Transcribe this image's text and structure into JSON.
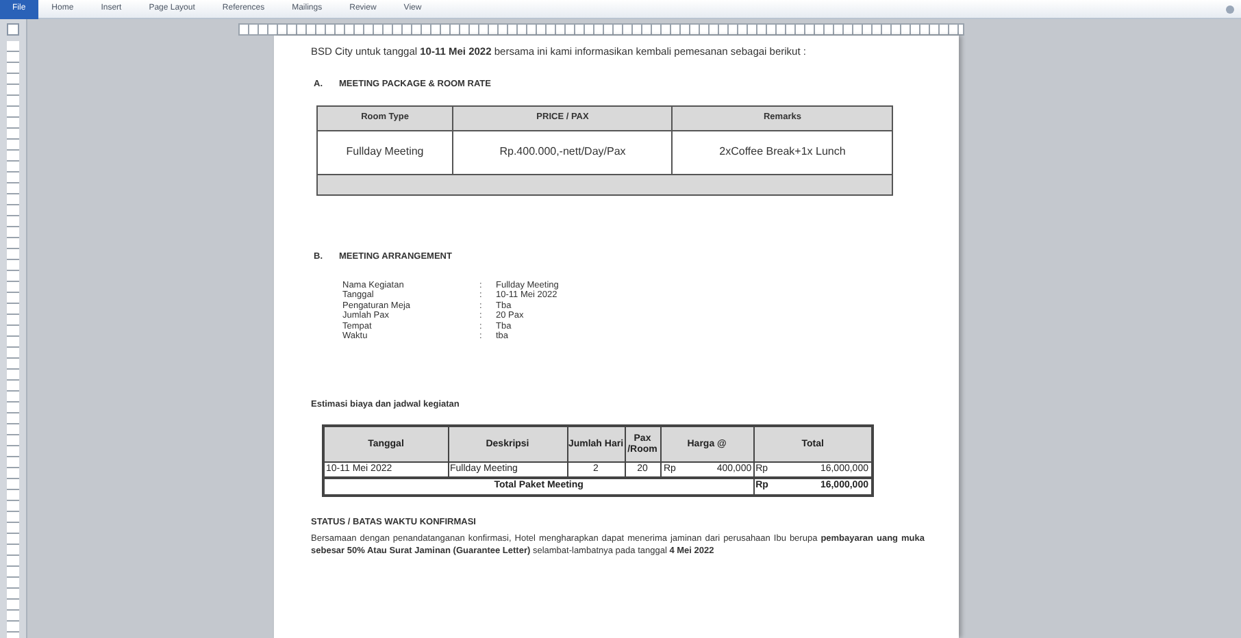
{
  "ribbon": {
    "tabs": [
      {
        "label": "File",
        "selected": true
      },
      {
        "label": "Home",
        "selected": false
      },
      {
        "label": "Insert",
        "selected": false
      },
      {
        "label": "Page Layout",
        "selected": false
      },
      {
        "label": "References",
        "selected": false
      },
      {
        "label": "Mailings",
        "selected": false
      },
      {
        "label": "Review",
        "selected": false
      },
      {
        "label": "View",
        "selected": false
      }
    ]
  },
  "document": {
    "intro": "BSD City untuk tanggal **10-11 Mei 2022** bersama ini kami informasikan kembali pemesanan sebagai berikut :",
    "section_a": {
      "number": "A.",
      "heading": "MEETING PACKAGE & ROOM RATE",
      "table": {
        "columns": [
          "Room Type",
          "PRICE / PAX",
          "Remarks"
        ],
        "rows": [
          [
            "Fullday Meeting",
            "Rp.400.000,-nett/Day/Pax",
            "2xCoffee Break+1x Lunch"
          ]
        ]
      }
    },
    "section_b": {
      "number": "B.",
      "heading": "MEETING ARRANGEMENT",
      "fields": [
        {
          "label": "Nama Kegiatan",
          "separator": ":",
          "value": "Fullday Meeting"
        },
        {
          "label": "Tanggal",
          "separator": ":",
          "value": "10-11 Mei 2022"
        },
        {
          "label": "Pengaturan Meja",
          "separator": ":",
          "value": "Tba"
        },
        {
          "label": "Jumlah Pax",
          "separator": ":",
          "value": "20 Pax"
        },
        {
          "label": "Tempat",
          "separator": ":",
          "value": "Tba"
        },
        {
          "label": "Waktu",
          "separator": ":",
          "value": "tba"
        }
      ]
    },
    "estimate": {
      "heading": "Estimasi biaya dan jadwal kegiatan",
      "table": {
        "columns": [
          "Tanggal",
          "Deskripsi",
          "Jumlah Hari",
          "Pax /Room",
          "Harga @",
          "Total"
        ],
        "rows": [
          {
            "date": "10-11 Mei 2022",
            "description": "Fullday Meeting",
            "days": "2",
            "pax": "20",
            "price_currency": "Rp",
            "price": "400,000",
            "total_currency": "Rp",
            "total": "16,000,000"
          }
        ],
        "footer": {
          "label": "Total Paket Meeting",
          "currency": "Rp",
          "total": "16,000,000"
        }
      }
    },
    "status": {
      "heading": "STATUS / BATAS WAKTU KONFIRMASI",
      "text": "Bersamaan dengan penandatanganan konfirmasi, Hotel mengharapkan dapat menerima jaminan dari perusahaan Ibu berupa **pembayaran uang muka sebesar 50% Atau Surat Jaminan (Guarantee Letter)** selambat-lambatnya pada tanggal  **4 Mei 2022**"
    }
  }
}
